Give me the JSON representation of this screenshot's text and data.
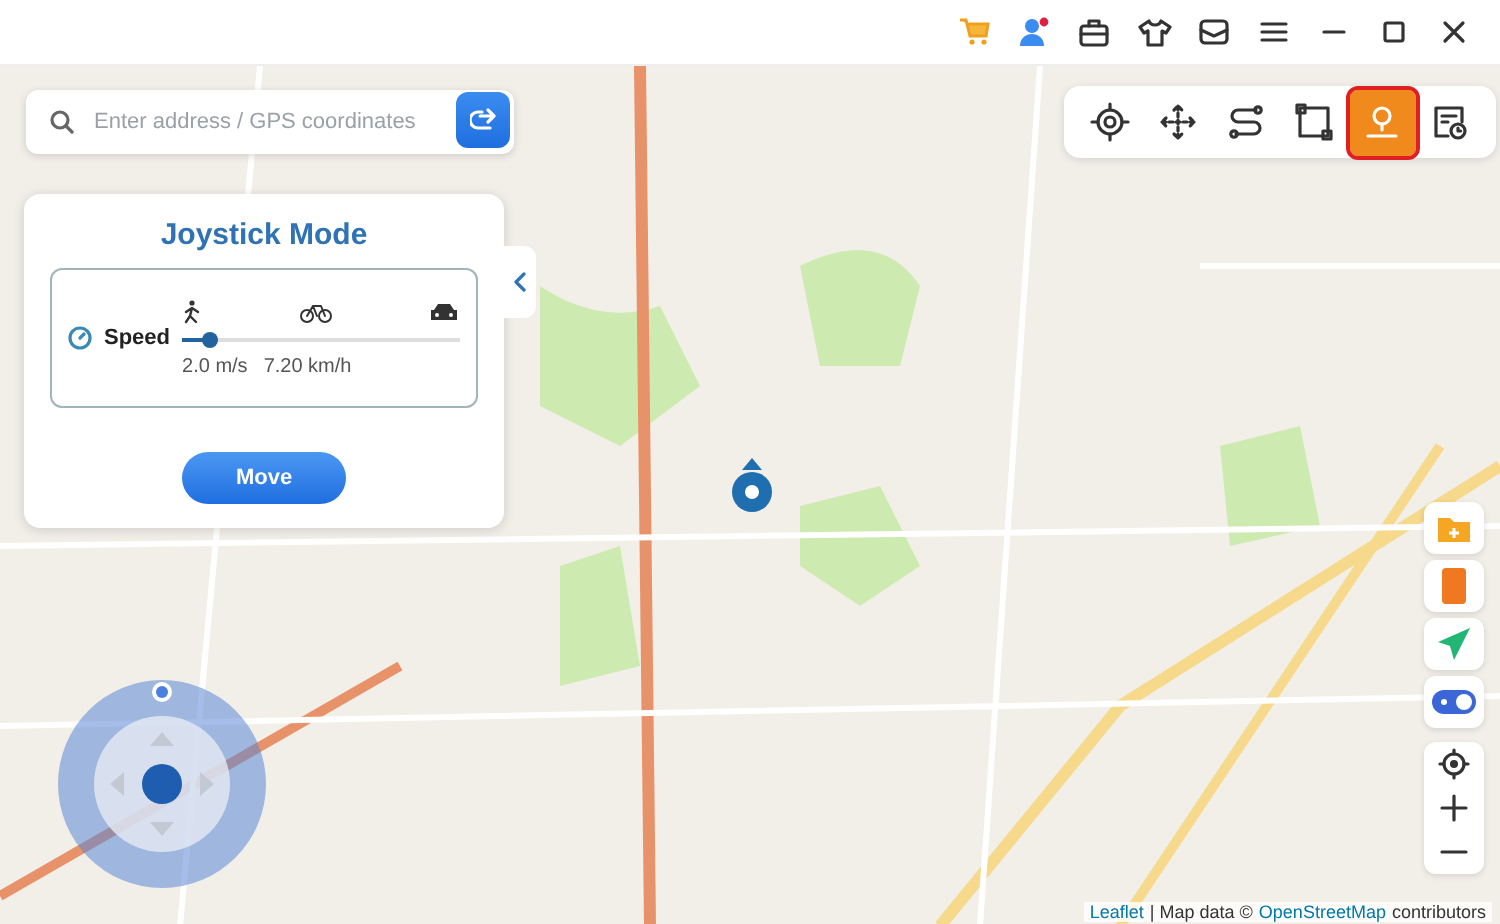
{
  "title_bar": {
    "icons": [
      {
        "kind": "cart"
      },
      {
        "kind": "user",
        "badge": true
      },
      {
        "kind": "toolbox"
      },
      {
        "kind": "shirt"
      },
      {
        "kind": "mail"
      },
      {
        "kind": "menu"
      },
      {
        "kind": "minimize"
      },
      {
        "kind": "maximize"
      },
      {
        "kind": "close"
      }
    ]
  },
  "search": {
    "placeholder": "Enter address / GPS coordinates"
  },
  "mode_tools": [
    {
      "kind": "teleport",
      "selected": false
    },
    {
      "kind": "two-spot",
      "selected": false
    },
    {
      "kind": "multi-spot",
      "selected": false
    },
    {
      "kind": "area",
      "selected": false
    },
    {
      "kind": "joystick",
      "selected": true
    },
    {
      "kind": "history",
      "selected": false
    }
  ],
  "panel": {
    "title": "Joystick Mode",
    "speed_label": "Speed",
    "level": 0.1,
    "speed_ms": "2.0 m/s",
    "speed_kmh": "7.20 km/h",
    "button": "Move"
  },
  "side_tools": [
    {
      "kind": "folder"
    },
    {
      "kind": "phone"
    },
    {
      "kind": "send"
    },
    {
      "kind": "toggle"
    }
  ],
  "zoom_tools": [
    {
      "kind": "locate"
    },
    {
      "kind": "zoom-in"
    },
    {
      "kind": "zoom-out"
    }
  ],
  "attribution": {
    "leaflet": "Leaflet",
    "middle": "| Map data ©",
    "osm": "OpenStreetMap",
    "suffix": "contributors"
  }
}
